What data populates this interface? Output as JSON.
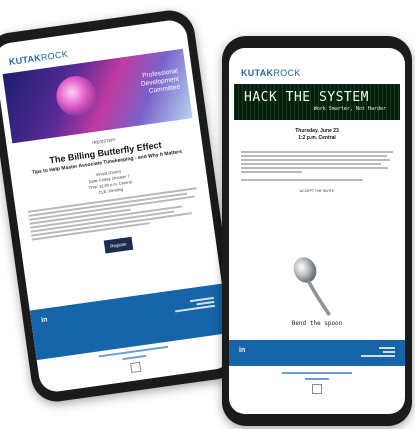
{
  "phone1": {
    "logo": {
      "kutak": "KUTAK",
      "rock": "ROCK"
    },
    "hero_text": "Professional Development Committee",
    "registration_label": "*REGISTER*",
    "title": "The Billing Butterfly Effect",
    "subtitle": "Tips to Help Master Associate Timekeeping - and Why It Matters",
    "event_meta": [
      "Virtual (Zoom)",
      "Date: Friday, October 7",
      "Time: 12:00 p.m. Central",
      "CLE: Pending"
    ],
    "button_label": "Register",
    "footer_social": "in"
  },
  "phone2": {
    "logo": {
      "kutak": "KUTAK",
      "rock": "ROCK"
    },
    "hero_title": "HACK THE SYSTEM",
    "hero_subtitle": "Work Smarter, Not Harder",
    "date_line": "Thursday, June 23",
    "time_line": "1:2 p.m. Central",
    "link_label": "ACCEPT THE INVITE",
    "caption": "Bend the spoon",
    "footer_social": "in"
  },
  "colors": {
    "brand_blue": "#1565a8",
    "navy_button": "#1b2b52"
  }
}
